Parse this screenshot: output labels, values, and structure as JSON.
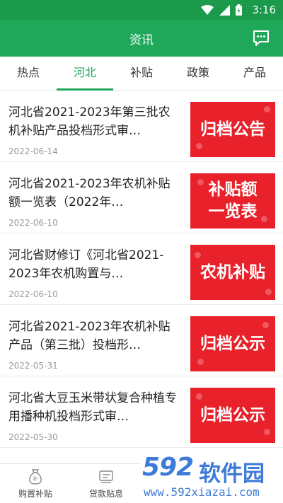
{
  "status_bar": {
    "time": "3:16"
  },
  "app_bar": {
    "title": "资讯",
    "message_icon": "message-icon"
  },
  "tabs": [
    {
      "label": "热点"
    },
    {
      "label": "河北"
    },
    {
      "label": "补贴"
    },
    {
      "label": "政策"
    },
    {
      "label": "产品"
    }
  ],
  "active_tab": "河北",
  "news": [
    {
      "title": "河北省2021-2023年第三批农机补贴产品投档形式审…",
      "date": "2022-06-14",
      "thumb_text": "归档公告"
    },
    {
      "title": "河北省2021-2023年农机补贴额一览表（2022年…",
      "date": "2022-06-10",
      "thumb_text": "补贴额\n一览表"
    },
    {
      "title": " 河北省财修订《河北省2021-2023年农机购置与…",
      "date": "2022-06-10",
      "thumb_text": "农机补贴"
    },
    {
      "title": "河北省2021-2023年农机补贴产品（第三批）投档形…",
      "date": "2022-05-31",
      "thumb_text": "归档公示"
    },
    {
      "title": "河北省大豆玉米带状复合种植专用播种机投档形式审…",
      "date": "2022-05-30",
      "thumb_text": "归档公示"
    }
  ],
  "bottom_nav": [
    {
      "label": "购置补贴",
      "icon": "money-bag-icon"
    },
    {
      "label": "贷款贴息",
      "icon": "banknote-icon"
    }
  ],
  "watermark": {
    "logo": "592",
    "name": "软件园",
    "url": "www.592xiazai.com"
  },
  "colors": {
    "brand_green": "#1fa85a",
    "thumb_red": "#e8212b",
    "watermark_blue": "#3d7bd8"
  }
}
